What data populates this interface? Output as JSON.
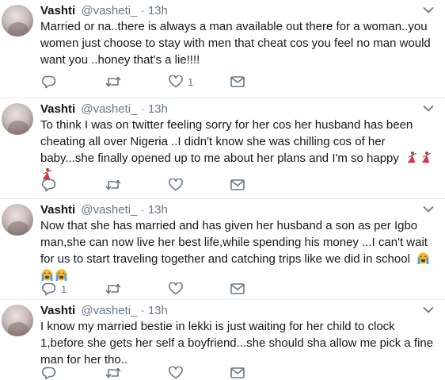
{
  "tweets": [
    {
      "name": "Vashti",
      "handle": "@vasheti_",
      "separator": "·",
      "time": "13h",
      "text": "Married or na..there is always a man available out there for a woman..you women just choose to stay with men that cheat cos you feel no man would want you ..honey that's a lie!!!!",
      "reply_count": "",
      "retweet_count": "",
      "like_count": "1"
    },
    {
      "name": "Vashti",
      "handle": "@vasheti_",
      "separator": "·",
      "time": "13h",
      "text": "To think I was on twitter feeling sorry for her cos her husband has been cheating all over Nigeria ..I didn't know she was chilling cos of her baby...she finally opened up to me about her plans and I'm so happy",
      "emojis": [
        "dancer-emoji",
        "dancer-emoji",
        "dancer-emoji"
      ],
      "reply_count": "",
      "retweet_count": "",
      "like_count": ""
    },
    {
      "name": "Vashti",
      "handle": "@vasheti_",
      "separator": "·",
      "time": "13h",
      "text": "Now that she has married and has given her husband a son as per Igbo man,she can now live her best life,while spending his money ...I can't wait for us to start traveling together and catching trips like we did in school",
      "emojis": [
        "loudly-crying-emoji",
        "loudly-crying-emoji",
        "loudly-crying-emoji"
      ],
      "reply_count": "1",
      "retweet_count": "",
      "like_count": ""
    },
    {
      "name": "Vashti",
      "handle": "@vasheti_",
      "separator": "·",
      "time": "13h",
      "text": "I know my married bestie in lekki is just waiting for her child to clock 1,before  she gets her self a boyfriend...she should sha allow me pick a fine man for her tho..",
      "reply_count": "",
      "retweet_count": "",
      "like_count": ""
    }
  ],
  "colors": {
    "text": "#14171a",
    "secondary": "#657786",
    "divider": "#e6ecf0",
    "dancer": "#d9324a",
    "crying_face": "#f5b92e",
    "tears": "#4aa3df"
  }
}
